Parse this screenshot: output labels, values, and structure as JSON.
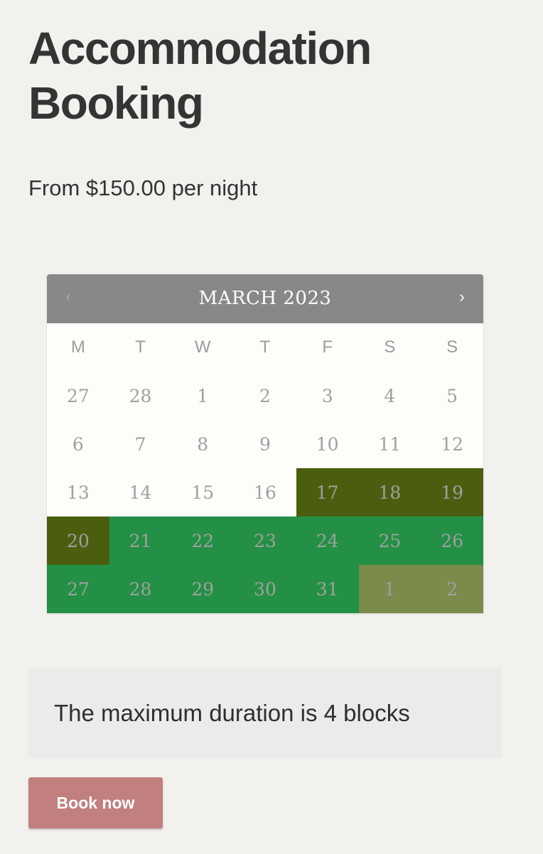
{
  "page": {
    "title": "Accommodation Booking",
    "price_text": "From $150.00 per night"
  },
  "calendar": {
    "month_label": "MARCH 2023",
    "prev_icon": "‹",
    "next_icon": "›",
    "weekdays": [
      "M",
      "T",
      "W",
      "T",
      "F",
      "S",
      "S"
    ],
    "weeks": [
      [
        {
          "day": "27",
          "state": "past"
        },
        {
          "day": "28",
          "state": "past"
        },
        {
          "day": "1",
          "state": "past"
        },
        {
          "day": "2",
          "state": "past"
        },
        {
          "day": "3",
          "state": "past"
        },
        {
          "day": "4",
          "state": "past"
        },
        {
          "day": "5",
          "state": "past"
        }
      ],
      [
        {
          "day": "6",
          "state": "past"
        },
        {
          "day": "7",
          "state": "past"
        },
        {
          "day": "8",
          "state": "past"
        },
        {
          "day": "9",
          "state": "past"
        },
        {
          "day": "10",
          "state": "past"
        },
        {
          "day": "11",
          "state": "past"
        },
        {
          "day": "12",
          "state": "past"
        }
      ],
      [
        {
          "day": "13",
          "state": "past"
        },
        {
          "day": "14",
          "state": "past"
        },
        {
          "day": "15",
          "state": "past"
        },
        {
          "day": "16",
          "state": "past"
        },
        {
          "day": "17",
          "state": "dark"
        },
        {
          "day": "18",
          "state": "dark"
        },
        {
          "day": "19",
          "state": "dark"
        }
      ],
      [
        {
          "day": "20",
          "state": "dark"
        },
        {
          "day": "21",
          "state": "green"
        },
        {
          "day": "22",
          "state": "green"
        },
        {
          "day": "23",
          "state": "green"
        },
        {
          "day": "24",
          "state": "green"
        },
        {
          "day": "25",
          "state": "green"
        },
        {
          "day": "26",
          "state": "green"
        }
      ],
      [
        {
          "day": "27",
          "state": "green"
        },
        {
          "day": "28",
          "state": "green"
        },
        {
          "day": "29",
          "state": "green"
        },
        {
          "day": "30",
          "state": "green"
        },
        {
          "day": "31",
          "state": "green"
        },
        {
          "day": "1",
          "state": "olive"
        },
        {
          "day": "2",
          "state": "olive"
        }
      ]
    ],
    "colors": {
      "header": "#888888",
      "dark": "#4b5e10",
      "green": "#239045",
      "olive": "#7b8b4c"
    }
  },
  "notice": {
    "text": "The maximum duration is 4 blocks"
  },
  "actions": {
    "book_label": "Book now",
    "book_color": "#c1807f"
  }
}
